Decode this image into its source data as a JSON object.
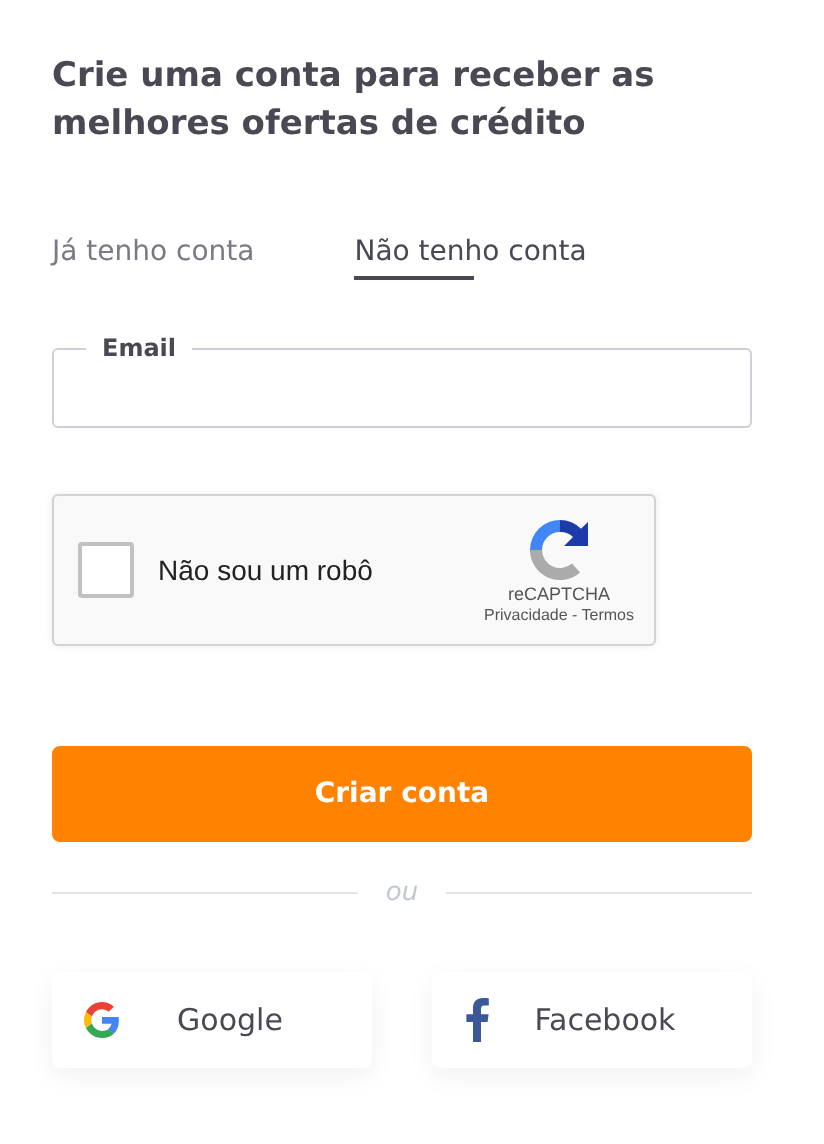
{
  "heading": "Crie uma conta para receber as melhores ofertas de crédito",
  "tabs": [
    {
      "label": "Já tenho conta",
      "selected": false
    },
    {
      "label": "Não tenho conta",
      "selected": true
    }
  ],
  "email_field": {
    "label": "Email"
  },
  "captcha": {
    "label": "Não sou um robô",
    "checked": false,
    "brand": "reCAPTCHA",
    "links": "Privacidade - Termos"
  },
  "submit_button": "Criar conta",
  "divider": "ou",
  "social_buttons": [
    {
      "kind": "google",
      "label": "Google"
    },
    {
      "kind": "facebook",
      "label": "Facebook"
    }
  ]
}
